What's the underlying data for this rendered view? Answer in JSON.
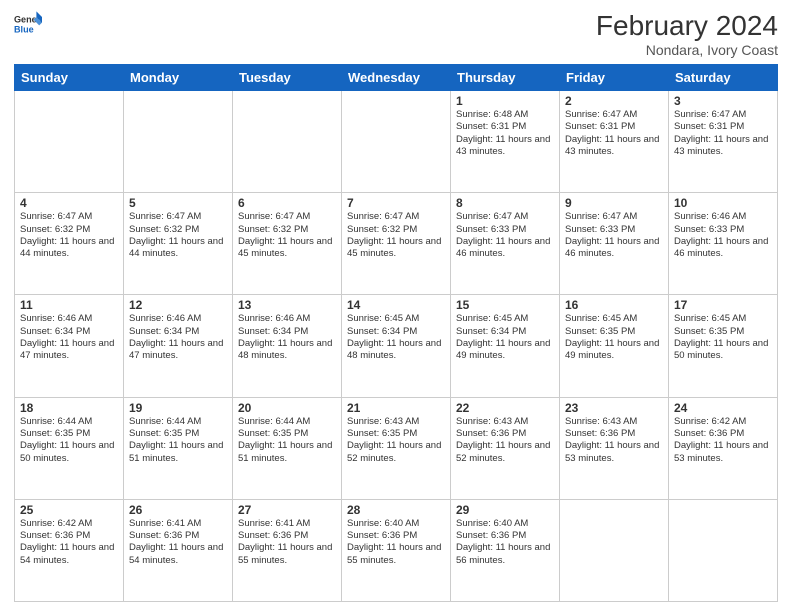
{
  "header": {
    "logo_general": "General",
    "logo_blue": "Blue",
    "month_year": "February 2024",
    "location": "Nondara, Ivory Coast"
  },
  "days_of_week": [
    "Sunday",
    "Monday",
    "Tuesday",
    "Wednesday",
    "Thursday",
    "Friday",
    "Saturday"
  ],
  "weeks": [
    [
      {
        "day": "",
        "info": ""
      },
      {
        "day": "",
        "info": ""
      },
      {
        "day": "",
        "info": ""
      },
      {
        "day": "",
        "info": ""
      },
      {
        "day": "1",
        "info": "Sunrise: 6:48 AM\nSunset: 6:31 PM\nDaylight: 11 hours and 43 minutes."
      },
      {
        "day": "2",
        "info": "Sunrise: 6:47 AM\nSunset: 6:31 PM\nDaylight: 11 hours and 43 minutes."
      },
      {
        "day": "3",
        "info": "Sunrise: 6:47 AM\nSunset: 6:31 PM\nDaylight: 11 hours and 43 minutes."
      }
    ],
    [
      {
        "day": "4",
        "info": "Sunrise: 6:47 AM\nSunset: 6:32 PM\nDaylight: 11 hours and 44 minutes."
      },
      {
        "day": "5",
        "info": "Sunrise: 6:47 AM\nSunset: 6:32 PM\nDaylight: 11 hours and 44 minutes."
      },
      {
        "day": "6",
        "info": "Sunrise: 6:47 AM\nSunset: 6:32 PM\nDaylight: 11 hours and 45 minutes."
      },
      {
        "day": "7",
        "info": "Sunrise: 6:47 AM\nSunset: 6:32 PM\nDaylight: 11 hours and 45 minutes."
      },
      {
        "day": "8",
        "info": "Sunrise: 6:47 AM\nSunset: 6:33 PM\nDaylight: 11 hours and 46 minutes."
      },
      {
        "day": "9",
        "info": "Sunrise: 6:47 AM\nSunset: 6:33 PM\nDaylight: 11 hours and 46 minutes."
      },
      {
        "day": "10",
        "info": "Sunrise: 6:46 AM\nSunset: 6:33 PM\nDaylight: 11 hours and 46 minutes."
      }
    ],
    [
      {
        "day": "11",
        "info": "Sunrise: 6:46 AM\nSunset: 6:34 PM\nDaylight: 11 hours and 47 minutes."
      },
      {
        "day": "12",
        "info": "Sunrise: 6:46 AM\nSunset: 6:34 PM\nDaylight: 11 hours and 47 minutes."
      },
      {
        "day": "13",
        "info": "Sunrise: 6:46 AM\nSunset: 6:34 PM\nDaylight: 11 hours and 48 minutes."
      },
      {
        "day": "14",
        "info": "Sunrise: 6:45 AM\nSunset: 6:34 PM\nDaylight: 11 hours and 48 minutes."
      },
      {
        "day": "15",
        "info": "Sunrise: 6:45 AM\nSunset: 6:34 PM\nDaylight: 11 hours and 49 minutes."
      },
      {
        "day": "16",
        "info": "Sunrise: 6:45 AM\nSunset: 6:35 PM\nDaylight: 11 hours and 49 minutes."
      },
      {
        "day": "17",
        "info": "Sunrise: 6:45 AM\nSunset: 6:35 PM\nDaylight: 11 hours and 50 minutes."
      }
    ],
    [
      {
        "day": "18",
        "info": "Sunrise: 6:44 AM\nSunset: 6:35 PM\nDaylight: 11 hours and 50 minutes."
      },
      {
        "day": "19",
        "info": "Sunrise: 6:44 AM\nSunset: 6:35 PM\nDaylight: 11 hours and 51 minutes."
      },
      {
        "day": "20",
        "info": "Sunrise: 6:44 AM\nSunset: 6:35 PM\nDaylight: 11 hours and 51 minutes."
      },
      {
        "day": "21",
        "info": "Sunrise: 6:43 AM\nSunset: 6:35 PM\nDaylight: 11 hours and 52 minutes."
      },
      {
        "day": "22",
        "info": "Sunrise: 6:43 AM\nSunset: 6:36 PM\nDaylight: 11 hours and 52 minutes."
      },
      {
        "day": "23",
        "info": "Sunrise: 6:43 AM\nSunset: 6:36 PM\nDaylight: 11 hours and 53 minutes."
      },
      {
        "day": "24",
        "info": "Sunrise: 6:42 AM\nSunset: 6:36 PM\nDaylight: 11 hours and 53 minutes."
      }
    ],
    [
      {
        "day": "25",
        "info": "Sunrise: 6:42 AM\nSunset: 6:36 PM\nDaylight: 11 hours and 54 minutes."
      },
      {
        "day": "26",
        "info": "Sunrise: 6:41 AM\nSunset: 6:36 PM\nDaylight: 11 hours and 54 minutes."
      },
      {
        "day": "27",
        "info": "Sunrise: 6:41 AM\nSunset: 6:36 PM\nDaylight: 11 hours and 55 minutes."
      },
      {
        "day": "28",
        "info": "Sunrise: 6:40 AM\nSunset: 6:36 PM\nDaylight: 11 hours and 55 minutes."
      },
      {
        "day": "29",
        "info": "Sunrise: 6:40 AM\nSunset: 6:36 PM\nDaylight: 11 hours and 56 minutes."
      },
      {
        "day": "",
        "info": ""
      },
      {
        "day": "",
        "info": ""
      }
    ]
  ]
}
